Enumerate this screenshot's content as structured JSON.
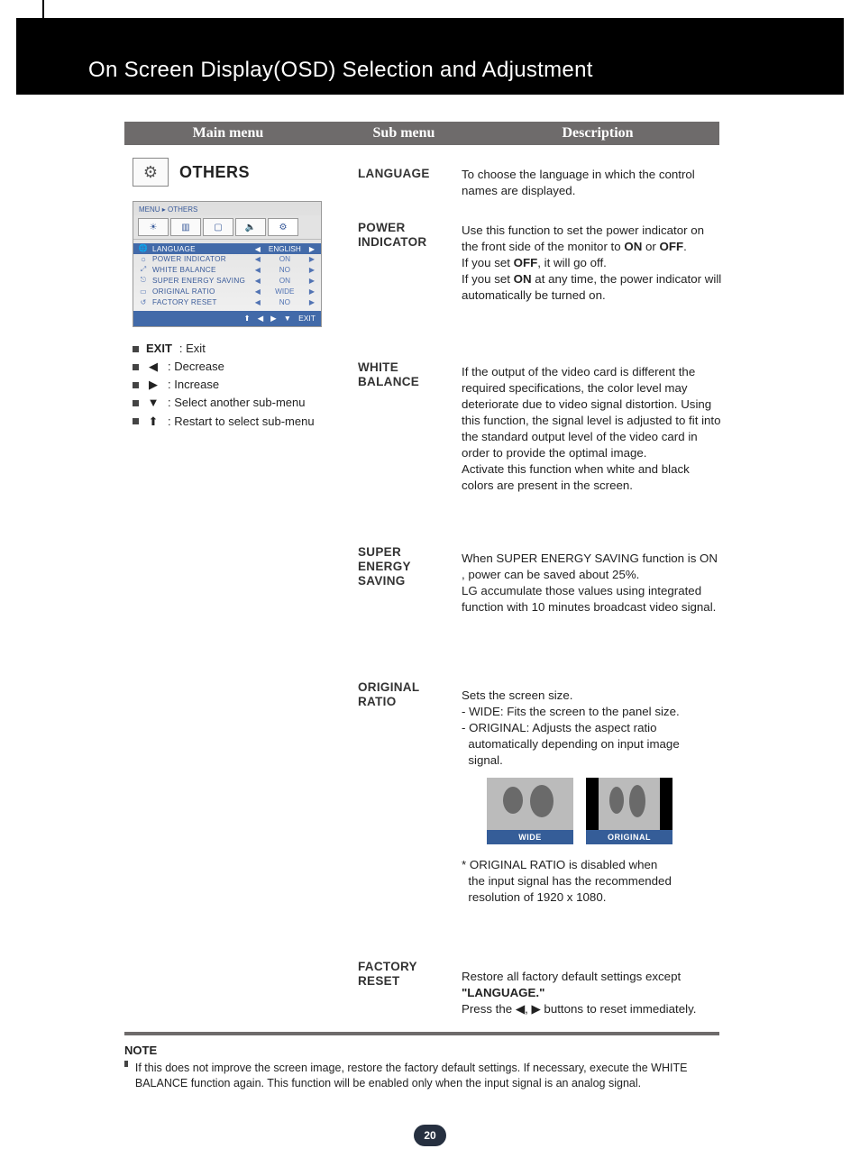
{
  "page": {
    "title": "On Screen Display(OSD) Selection and Adjustment",
    "number": "20"
  },
  "columns": {
    "c1": "Main menu",
    "c2": "Sub menu",
    "c3": "Description"
  },
  "others_header": "OTHERS",
  "osd": {
    "breadcrumb": "MENU  ▸  OTHERS",
    "rows": [
      {
        "icon": "🌐",
        "label": "LANGUAGE",
        "value": "ENGLISH",
        "hl": true
      },
      {
        "icon": "☼",
        "label": "POWER INDICATOR",
        "value": "ON"
      },
      {
        "icon": "⤢",
        "label": "WHITE BALANCE",
        "value": "NO"
      },
      {
        "icon": "⎋",
        "label": "SUPER ENERGY SAVING",
        "value": "ON"
      },
      {
        "icon": "▭",
        "label": "ORIGINAL RATIO",
        "value": "WIDE"
      },
      {
        "icon": "↺",
        "label": "FACTORY RESET",
        "value": "NO"
      }
    ],
    "bottom": [
      "⬆",
      "◀",
      "▶",
      "▼",
      "EXIT"
    ]
  },
  "legend": [
    {
      "sym_text": "EXIT",
      "text": " : Exit",
      "bold": true
    },
    {
      "sym": "◀",
      "text": ": Decrease"
    },
    {
      "sym": "▶",
      "text": ": Increase"
    },
    {
      "sym": "▼",
      "text": ": Select another sub-menu"
    },
    {
      "sym": "⬆",
      "text": ": Restart to select sub-menu"
    }
  ],
  "items": {
    "language": {
      "sub": "LANGUAGE",
      "desc": "To choose the language in which the control names are displayed."
    },
    "power": {
      "sub": "POWER INDICATOR",
      "d1": "Use this function to set the power indicator on the front side of the monitor to ",
      "d1b1": "ON",
      "d1m": " or ",
      "d1b2": "OFF",
      "d1e": ".",
      "d2a": "If you set ",
      "d2b": "OFF",
      "d2c": ", it will go off.",
      "d3a": "If you set ",
      "d3b": "ON",
      "d3c": " at any time, the power indicator will automatically be turned on."
    },
    "white": {
      "sub": "WHITE BALANCE",
      "desc": "If the output of the video card is different the required specifications, the color level may deteriorate due to video signal distortion. Using this function, the signal level is adjusted to fit into the standard output level of the video card in order to provide the optimal image.\nActivate this function when white and black colors are present in the screen."
    },
    "ses": {
      "sub": "SUPER ENERGY SAVING",
      "desc": "When SUPER ENERGY SAVING function is ON , power can be saved about 25%.\nLG accumulate those values using integrated function with 10 minutes broadcast video signal."
    },
    "ratio": {
      "sub": "ORIGINAL RATIO",
      "l1": "Sets the screen size.",
      "l2": "- WIDE: Fits the screen to the panel  size.",
      "l3": "- ORIGINAL: Adjusts the aspect ratio automatically depending on input image signal.",
      "wide_cap": "WIDE",
      "orig_cap": "ORIGINAL",
      "note": "* ORIGINAL RATIO is disabled when the input signal has the recommended resolution of 1920 x 1080."
    },
    "factory": {
      "sub": "FACTORY RESET",
      "d1": "Restore all factory default settings except ",
      "d1b": "\"LANGUAGE.\"",
      "d2a": "Press the  ",
      "d2b": "◀",
      "d2c": ", ",
      "d2d": "▶",
      "d2e": " buttons to reset immediately."
    }
  },
  "note": {
    "hdr": "NOTE",
    "body": "If this does not improve the screen image, restore the factory default settings. If necessary, execute the WHITE BALANCE function again. This function will be enabled only when the input signal is an analog signal."
  }
}
